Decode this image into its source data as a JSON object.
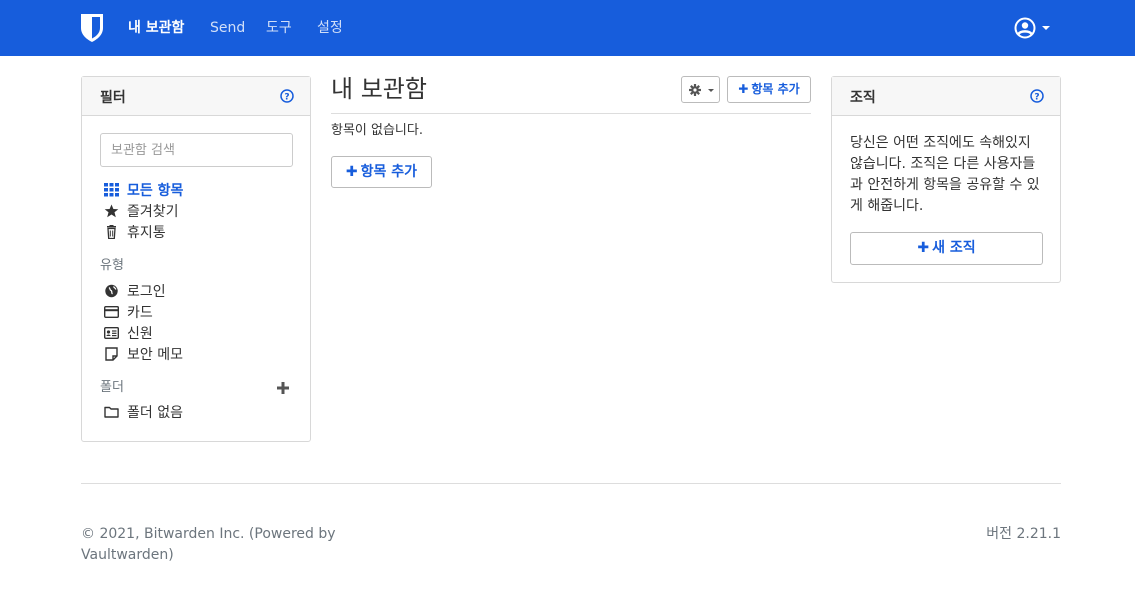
{
  "colors": {
    "brand": "#175ddc",
    "muted": "#6c757d"
  },
  "nav": {
    "logo_icon": "bitwarden-shield-icon",
    "items": [
      {
        "label": "내 보관함",
        "active": true
      },
      {
        "label": "Send",
        "active": false
      },
      {
        "label": "도구",
        "active": false
      },
      {
        "label": "설정",
        "active": false
      }
    ],
    "account_icon": "user-circle-icon"
  },
  "filter": {
    "title": "필터",
    "search_placeholder": "보관함 검색",
    "all_items": "모든 항목",
    "favorites": "즐겨찾기",
    "trash": "휴지통",
    "types_heading": "유형",
    "types": [
      "로그인",
      "카드",
      "신원",
      "보안 메모"
    ],
    "folders_heading": "폴더",
    "no_folder": "폴더 없음"
  },
  "main": {
    "title": "내 보관함",
    "add_item_label": "항목 추가",
    "empty_text": "항목이 없습니다."
  },
  "org": {
    "title": "조직",
    "description": "당신은 어떤 조직에도 속해있지 않습니다. 조직은 다른 사용자들과 안전하게 항목을 공유할 수 있게 해줍니다.",
    "new_org_label": "새 조직"
  },
  "footer": {
    "copyright": "© 2021, Bitwarden Inc. (Powered by Vaultwarden)",
    "version": "버전 2.21.1"
  }
}
